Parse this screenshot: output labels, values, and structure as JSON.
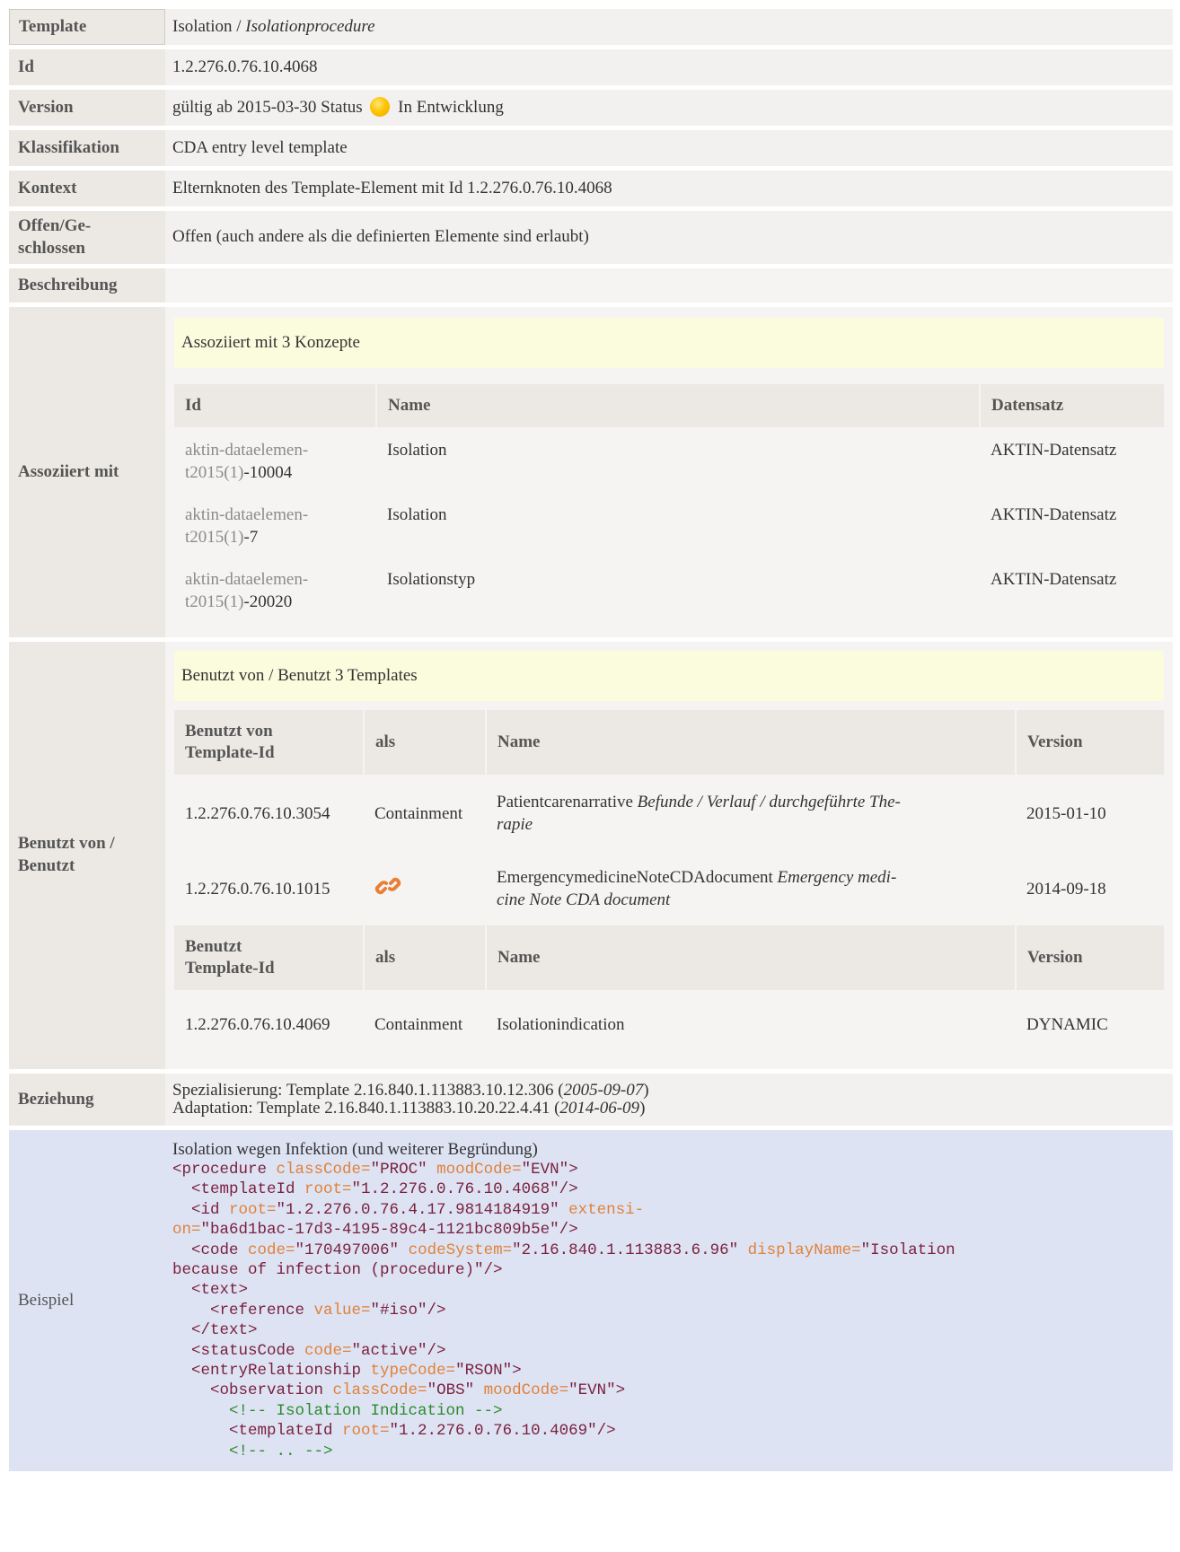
{
  "rows": {
    "template": {
      "label": "Template",
      "name": "Isolation",
      "sep": " / ",
      "display": "Isolationprocedure"
    },
    "id": {
      "label": "Id",
      "value": "1.2.276.0.76.10.4068"
    },
    "version": {
      "label": "Version",
      "prefix": "gültig ab 2015-03-30 Status",
      "status": "In Entwicklung",
      "status_color": "#ffc400"
    },
    "klass": {
      "label": "Klassifikation",
      "value": "CDA entry level template"
    },
    "kontext": {
      "label": "Kontext",
      "value": "Elternknoten des Template-Element mit Id 1.2.276.0.76.10.4068"
    },
    "offen": {
      "label": "Offen/Ge-schlossen",
      "value": "Offen (auch andere als die definierten Elemente sind erlaubt)"
    },
    "beschreibung": {
      "label": "Beschreibung"
    },
    "assoc": {
      "label": "Assoziiert mit",
      "header": "Assoziiert mit 3 Konzepte",
      "columns": [
        "Id",
        "Name",
        "Datensatz"
      ],
      "items": [
        {
          "id_a": "aktin-dataelemen-",
          "id_b": "t2015(1)",
          "id_c": "-10004",
          "name": "Isolation",
          "dataset": "AKTIN-Datensatz"
        },
        {
          "id_a": "aktin-dataelemen-",
          "id_b": "t2015(1)",
          "id_c": "-7",
          "name": "Isolation",
          "dataset": "AKTIN-Datensatz"
        },
        {
          "id_a": "aktin-dataelemen-",
          "id_b": "t2015(1)",
          "id_c": "-20020",
          "name": "Isolationstyp",
          "dataset": "AKTIN-Datensatz"
        }
      ]
    },
    "used": {
      "label": "Benutzt von / Benutzt",
      "header": "Benutzt von / Benutzt 3 Templates",
      "columns_by": [
        "Benutzt von Template-Id",
        "als",
        "Name",
        "Version"
      ],
      "by_items": [
        {
          "id": "1.2.276.0.76.10.3054",
          "as": "Containment",
          "name": "Patientcarenarrative",
          "display": "Befunde / Verlauf / durchgeführte The-rapie",
          "version": "2015-01-10"
        },
        {
          "id": "1.2.276.0.76.10.1015",
          "as_icon": "link-icon",
          "name": "EmergencymedicineNoteCDAdocument",
          "display": "Emergency medi-cine Note CDA document",
          "version": "2014-09-18"
        }
      ],
      "columns_uses": [
        "Benutzt Template-Id",
        "als",
        "Name",
        "Version"
      ],
      "uses_items": [
        {
          "id": "1.2.276.0.76.10.4069",
          "as": "Containment",
          "name": "Isolationindication",
          "version": "DYNAMIC"
        }
      ]
    },
    "beziehung": {
      "label": "Beziehung",
      "line1_prefix": "Spezialisierung: Template 2.16.840.1.113883.10.12.306 (",
      "line1_date": "2005-09-07",
      "line1_suffix": ")",
      "line2_prefix": "Adaptation: Template 2.16.840.1.113883.10.20.22.4.41 (",
      "line2_date": "2014-06-09",
      "line2_suffix": ")"
    },
    "beispiel": {
      "label": "Beispiel",
      "title": "Isolation wegen Infektion (und weiterer Begründung)"
    }
  },
  "code_lines": [
    [
      [
        "tag",
        "<procedure "
      ],
      [
        "attr",
        "classCode="
      ],
      [
        "str",
        "\"PROC\" "
      ],
      [
        "attr",
        "moodCode="
      ],
      [
        "str",
        "\"EVN\">"
      ]
    ],
    [
      [
        "tag",
        "  <templateId "
      ],
      [
        "attr",
        "root="
      ],
      [
        "str",
        "\"1.2.276.0.76.10.4068\"/>"
      ]
    ],
    [
      [
        "tag",
        "  <id "
      ],
      [
        "attr",
        "root="
      ],
      [
        "str",
        "\"1.2.276.0.76.4.17.9814184919\" "
      ],
      [
        "attr",
        "extensi-"
      ]
    ],
    [
      [
        "attr",
        "on="
      ],
      [
        "str",
        "\"ba6d1bac-17d3-4195-89c4-1121bc809b5e\"/>"
      ]
    ],
    [
      [
        "tag",
        "  <code "
      ],
      [
        "attr",
        "code="
      ],
      [
        "str",
        "\"170497006\" "
      ],
      [
        "attr",
        "codeSystem="
      ],
      [
        "str",
        "\"2.16.840.1.113883.6.96\" "
      ],
      [
        "attr",
        "displayName="
      ],
      [
        "str",
        "\"Isolation"
      ]
    ],
    [
      [
        "str",
        "because of infection (procedure)\"/>"
      ]
    ],
    [
      [
        "tag",
        "  <text>"
      ]
    ],
    [
      [
        "tag",
        "    <reference "
      ],
      [
        "attr",
        "value="
      ],
      [
        "str",
        "\"#iso\"/>"
      ]
    ],
    [
      [
        "tag",
        "  </text>"
      ]
    ],
    [
      [
        "tag",
        "  <statusCode "
      ],
      [
        "attr",
        "code="
      ],
      [
        "str",
        "\"active\"/>"
      ]
    ],
    [
      [
        "tag",
        "  <entryRelationship "
      ],
      [
        "attr",
        "typeCode="
      ],
      [
        "str",
        "\"RSON\">"
      ]
    ],
    [
      [
        "tag",
        "    <observation "
      ],
      [
        "attr",
        "classCode="
      ],
      [
        "str",
        "\"OBS\" "
      ],
      [
        "attr",
        "moodCode="
      ],
      [
        "str",
        "\"EVN\">"
      ]
    ],
    [
      [
        "com",
        "      <!-- Isolation Indication -->"
      ]
    ],
    [
      [
        "tag",
        "      <templateId "
      ],
      [
        "attr",
        "root="
      ],
      [
        "str",
        "\"1.2.276.0.76.10.4069\"/>"
      ]
    ],
    [
      [
        "com",
        "      <!-- .. -->"
      ]
    ]
  ]
}
